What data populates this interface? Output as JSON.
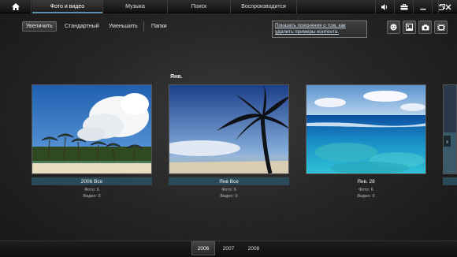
{
  "nav": {
    "tabs": [
      {
        "label": "Фото и видео",
        "active": true
      },
      {
        "label": "Музыка",
        "active": false
      },
      {
        "label": "Поиск",
        "active": false
      },
      {
        "label": "Воспроизводится",
        "active": false
      }
    ],
    "icons": [
      "home-icon",
      "volume-icon",
      "toolbox-icon",
      "minimize-icon",
      "restore-icon",
      "close-icon"
    ]
  },
  "toolbar": {
    "zoom_in": "Увеличить",
    "standard": "Стандартный",
    "zoom_out": "Уменьшить",
    "folders": "Папки",
    "hint_link": "Показать пояснения о том, как удалить примеры контента.",
    "tools": [
      "smiley-icon",
      "picture-icon",
      "camera-icon",
      "filmstrip-icon"
    ]
  },
  "group": {
    "month": "Янв."
  },
  "tiles": [
    {
      "caption": "2006 Все",
      "selected": true,
      "photos": "Фото: 6",
      "videos": "Видео: 0",
      "icon": "beach-palms-photo"
    },
    {
      "caption": "Янв Все",
      "selected": true,
      "photos": "Фото: 6",
      "videos": "Видео: 0",
      "icon": "palm-tree-photo"
    },
    {
      "caption": "Янв. 28",
      "selected": false,
      "photos": "Фото: 6",
      "videos": "Видео: 0",
      "icon": "ocean-reef-photo"
    }
  ],
  "next_arrow": "›",
  "years": [
    {
      "label": "2006",
      "active": true
    },
    {
      "label": "2007",
      "active": false
    },
    {
      "label": "2008",
      "active": false
    }
  ],
  "colors": {
    "accent": "#2a4a57",
    "link": "#cfe3f5",
    "tab_underline": "#5a8fb0"
  }
}
